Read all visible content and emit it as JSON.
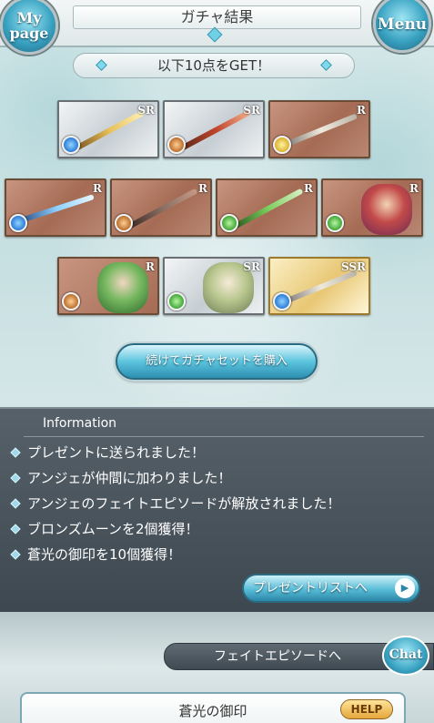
{
  "header": {
    "title": "ガチャ結果",
    "mypage_label": "My page",
    "menu_label": "Menu"
  },
  "result": {
    "banner": "以下10点をGET！",
    "items": [
      {
        "rarity": "SR",
        "element": "water",
        "kind": "weapon"
      },
      {
        "rarity": "SR",
        "element": "earth",
        "kind": "weapon"
      },
      {
        "rarity": "R",
        "element": "light",
        "kind": "weapon"
      },
      {
        "rarity": "R",
        "element": "water",
        "kind": "weapon"
      },
      {
        "rarity": "R",
        "element": "earth",
        "kind": "weapon"
      },
      {
        "rarity": "R",
        "element": "wind",
        "kind": "weapon"
      },
      {
        "rarity": "R",
        "element": "wind",
        "kind": "summon"
      },
      {
        "rarity": "R",
        "element": "earth",
        "kind": "character"
      },
      {
        "rarity": "SR",
        "element": "wind",
        "kind": "character"
      },
      {
        "rarity": "SSR",
        "element": "water",
        "kind": "weapon"
      }
    ]
  },
  "buy_button": "続けてガチャセットを購入",
  "info": {
    "title": "Information",
    "items": [
      "プレゼントに送られました！",
      "アンジェが仲間に加わりました！",
      "アンジェのフェイトエピソードが解放されました！",
      "ブロンズムーンを2個獲得！",
      "蒼光の御印を10個獲得！"
    ],
    "present_button": "プレゼントリストへ"
  },
  "fate_episode_button": "フェイトエピソードへ",
  "chat_button": "Chat",
  "card": {
    "title": "蒼光の御印",
    "help_label": "HELP"
  }
}
